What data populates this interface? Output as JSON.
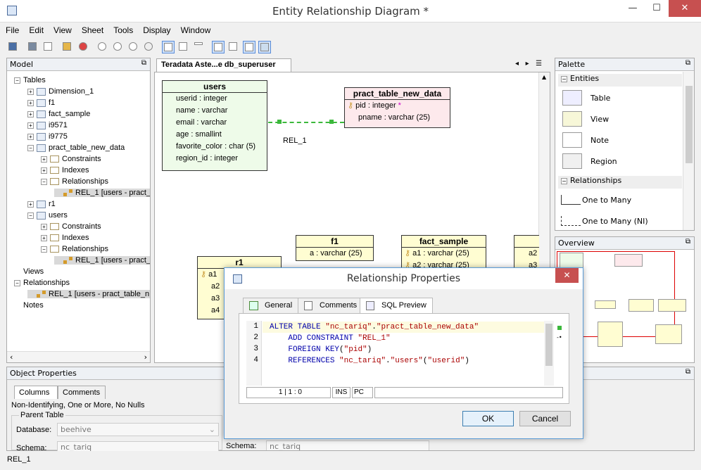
{
  "window": {
    "title": "Entity Relationship Diagram *",
    "minimize": "—",
    "maximize": "☐",
    "close": "✕"
  },
  "menu": [
    "File",
    "Edit",
    "View",
    "Sheet",
    "Tools",
    "Display",
    "Window"
  ],
  "model_panel": {
    "title": "Model",
    "tree": [
      {
        "label": "Tables",
        "indent": 0,
        "toggle": "−",
        "icon": "none"
      },
      {
        "label": "Dimension_1",
        "indent": 1,
        "toggle": "+",
        "icon": "table"
      },
      {
        "label": "f1",
        "indent": 1,
        "toggle": "+",
        "icon": "table"
      },
      {
        "label": "fact_sample",
        "indent": 1,
        "toggle": "+",
        "icon": "table"
      },
      {
        "label": "i9571",
        "indent": 1,
        "toggle": "+",
        "icon": "table"
      },
      {
        "label": "i9775",
        "indent": 1,
        "toggle": "+",
        "icon": "table"
      },
      {
        "label": "pract_table_new_data",
        "indent": 1,
        "toggle": "−",
        "icon": "table"
      },
      {
        "label": "Constraints",
        "indent": 2,
        "toggle": "+",
        "icon": "folder"
      },
      {
        "label": "Indexes",
        "indent": 2,
        "toggle": "+",
        "icon": "folder"
      },
      {
        "label": "Relationships",
        "indent": 2,
        "toggle": "−",
        "icon": "folder"
      },
      {
        "label": "REL_1 [users - pract_",
        "indent": 3,
        "toggle": "",
        "icon": "rel",
        "highlight": true
      },
      {
        "label": "r1",
        "indent": 1,
        "toggle": "+",
        "icon": "table"
      },
      {
        "label": "users",
        "indent": 1,
        "toggle": "−",
        "icon": "table"
      },
      {
        "label": "Constraints",
        "indent": 2,
        "toggle": "+",
        "icon": "folder"
      },
      {
        "label": "Indexes",
        "indent": 2,
        "toggle": "+",
        "icon": "folder"
      },
      {
        "label": "Relationships",
        "indent": 2,
        "toggle": "−",
        "icon": "folder"
      },
      {
        "label": "REL_1 [users - pract_",
        "indent": 3,
        "toggle": "",
        "icon": "rel",
        "highlight": true
      },
      {
        "label": "Views",
        "indent": 0,
        "toggle": "",
        "icon": "none"
      },
      {
        "label": "Relationships",
        "indent": 0,
        "toggle": "−",
        "icon": "none"
      },
      {
        "label": "REL_1 [users - pract_table_n",
        "indent": 1,
        "toggle": "",
        "icon": "rel",
        "highlight": true
      },
      {
        "label": "Notes",
        "indent": 0,
        "toggle": "",
        "icon": "none"
      }
    ]
  },
  "diagram": {
    "tab_label": "Teradata Aste...e db_superuser",
    "entities": {
      "users": {
        "name": "users",
        "cols": [
          "userid : integer",
          "name : varchar",
          "email : varchar",
          "age : smallint",
          "favorite_color : char (5)",
          "region_id : integer"
        ]
      },
      "pract": {
        "name": "pract_table_new_data",
        "cols": [
          "pid : integer",
          "pname : varchar (25)"
        ],
        "pk_marker": "*"
      },
      "f1": {
        "name": "f1",
        "cols": [
          "a : varchar (25)"
        ]
      },
      "fact_sample": {
        "name": "fact_sample",
        "cols": [
          "a1 : varchar (25)",
          "a2 : varchar (25)"
        ]
      },
      "r1": {
        "name": "r1",
        "cols": [
          "a1",
          "a2",
          "a3",
          "a4"
        ]
      },
      "right_partial": {
        "cols": [
          "a2",
          "a3"
        ]
      }
    },
    "relationship_label": "REL_1"
  },
  "palette": {
    "title": "Palette",
    "entities_header": "Entities",
    "entities": [
      "Table",
      "View",
      "Note",
      "Region"
    ],
    "relationships_header": "Relationships",
    "relationships": [
      "One to Many",
      "One to Many (NI)"
    ]
  },
  "overview": {
    "title": "Overview"
  },
  "object_properties": {
    "title": "Object Properties",
    "tabs": [
      "Columns",
      "Comments"
    ],
    "description": "Non-Identifying, One or More, No Nulls",
    "parent_table_label": "Parent Table",
    "database_label": "Database:",
    "database_value": "beehive",
    "schema_label": "Schema:",
    "schema_value": "nc_tariq",
    "schema_label_right": "Schema:",
    "schema_value_right": "nc_tariq"
  },
  "dialog": {
    "title": "Relationship Properties",
    "tabs": [
      "General",
      "Comments",
      "SQL Preview"
    ],
    "line_numbers": [
      "1",
      "2",
      "3",
      "4"
    ],
    "sql": [
      [
        {
          "t": "ALTER TABLE ",
          "c": "kw"
        },
        {
          "t": "\"nc_tariq\"",
          "c": "str"
        },
        {
          "t": ".",
          "c": ""
        },
        {
          "t": "\"pract_table_new_data\"",
          "c": "str"
        }
      ],
      [
        {
          "t": "    ADD CONSTRAINT ",
          "c": "kw"
        },
        {
          "t": "\"REL_1\"",
          "c": "str"
        }
      ],
      [
        {
          "t": "    FOREIGN KEY",
          "c": "kw"
        },
        {
          "t": "(",
          "c": ""
        },
        {
          "t": "\"pid\"",
          "c": "str"
        },
        {
          "t": ")",
          "c": ""
        }
      ],
      [
        {
          "t": "    REFERENCES ",
          "c": "kw"
        },
        {
          "t": "\"nc_tariq\"",
          "c": "str"
        },
        {
          "t": ".",
          "c": ""
        },
        {
          "t": "\"users\"",
          "c": "str"
        },
        {
          "t": "(",
          "c": ""
        },
        {
          "t": "\"userid\"",
          "c": "str"
        },
        {
          "t": ")",
          "c": ""
        }
      ]
    ],
    "status_pos": "1 | 1 : 0",
    "status_mode": "INS",
    "status_enc": "PC",
    "ok": "OK",
    "cancel": "Cancel"
  },
  "statusbar": {
    "text": "REL_1"
  }
}
